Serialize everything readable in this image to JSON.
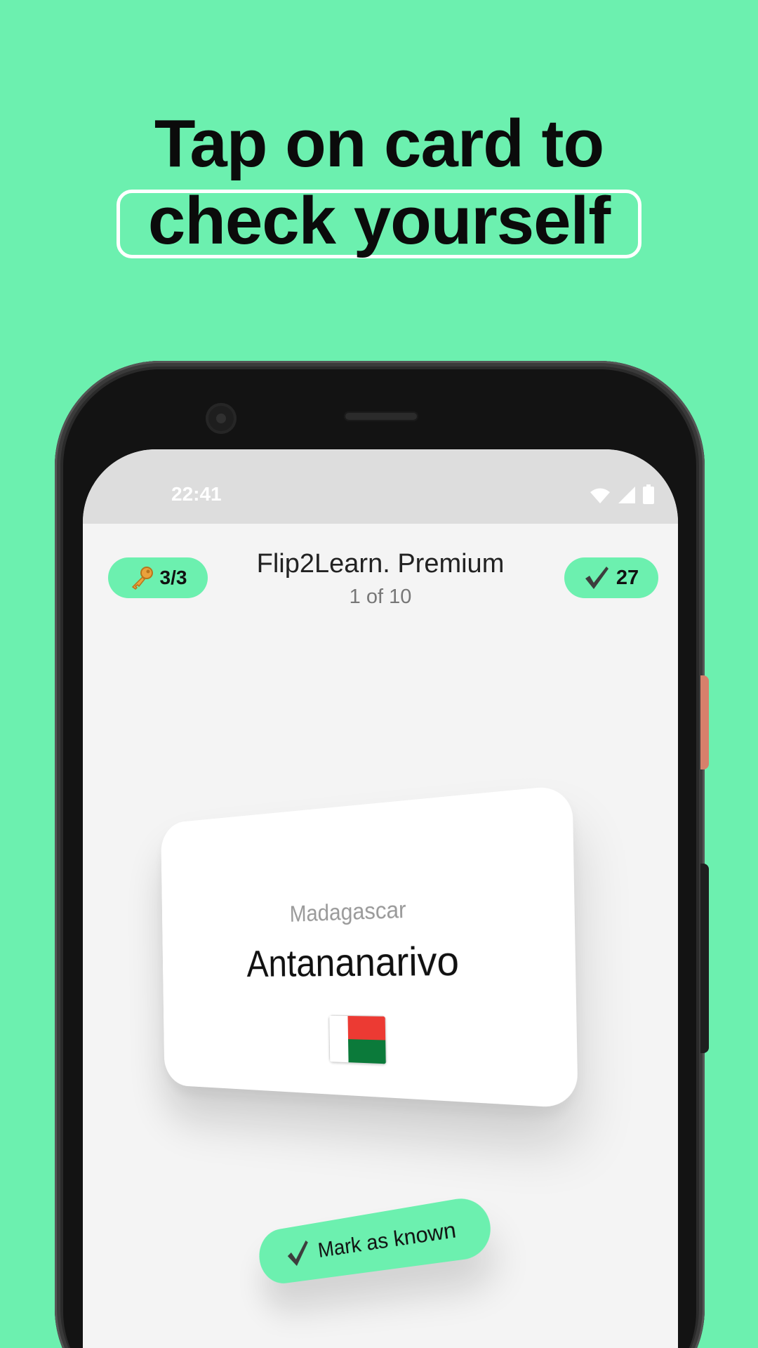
{
  "headline": {
    "line1": "Tap on card to",
    "line2": "check yourself"
  },
  "status_bar": {
    "time": "22:41",
    "icons": [
      "wifi-icon",
      "signal-icon",
      "battery-icon"
    ]
  },
  "app_header": {
    "keys_count": "3/3",
    "keys_icon": "key-icon",
    "title": "Flip2Learn. Premium",
    "progress": "1 of 10",
    "known_count": "27",
    "known_icon": "check-icon"
  },
  "card": {
    "country": "Madagascar",
    "capital": "Antananarivo",
    "flag": "madagascar-flag-icon"
  },
  "mark_button": {
    "label": "Mark as known",
    "icon": "check-icon"
  },
  "colors": {
    "background": "#6CF0AF",
    "accent": "#6CF0AF",
    "screen": "#F4F4F4",
    "status_bar": "#DDDDDD",
    "phone_frame": "#131313"
  }
}
